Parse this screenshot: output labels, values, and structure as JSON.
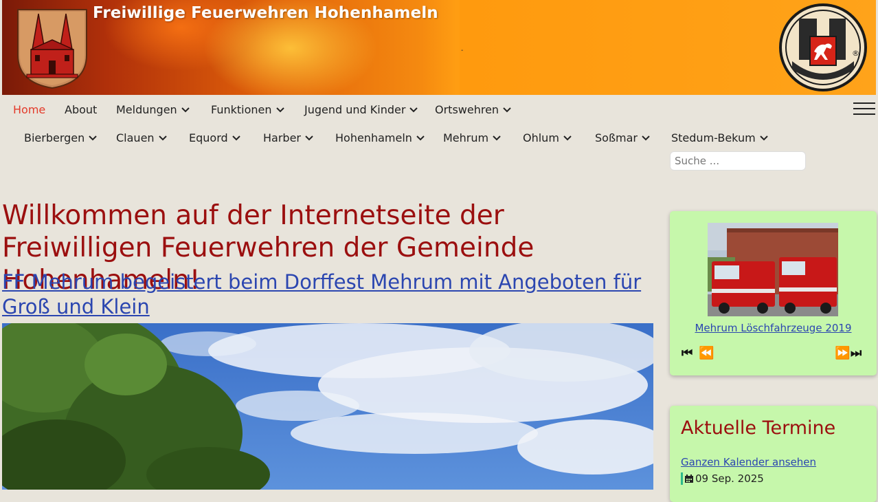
{
  "header": {
    "title": "Freiwillige Feuerwehren Hohenhameln",
    "separator": "-"
  },
  "nav": {
    "primary": [
      {
        "label": "Home",
        "active": true,
        "dropdown": false
      },
      {
        "label": "About",
        "dropdown": false
      },
      {
        "label": "Meldungen",
        "dropdown": true
      },
      {
        "label": "Funktionen",
        "dropdown": true
      },
      {
        "label": "Jugend und Kinder",
        "dropdown": true
      },
      {
        "label": "Ortswehren",
        "dropdown": true
      }
    ],
    "secondary": [
      {
        "label": "Bierbergen"
      },
      {
        "label": "Clauen"
      },
      {
        "label": "Equord"
      },
      {
        "label": "Harber"
      },
      {
        "label": "Hohenhameln"
      },
      {
        "label": "Mehrum"
      },
      {
        "label": "Ohlum"
      },
      {
        "label": "Soßmar"
      },
      {
        "label": "Stedum-Bekum"
      }
    ],
    "search_placeholder": "Suche ..."
  },
  "main": {
    "title": "Willkommen auf der Internetseite der Freiwilligen Feuerwehren der Gemeinde Hohenhameln!",
    "article_link": "FF Mehrum begeistert beim Dorffest Mehrum mit Angeboten für Groß und Klein"
  },
  "sidebar": {
    "gallery": {
      "caption": "Mehrum Löschfahrzeuge 2019",
      "controls": {
        "first": "⏮",
        "prev": "⏪",
        "next": "⏩",
        "last": "⏭"
      }
    },
    "events": {
      "title": "Aktuelle Termine",
      "calendar_link": "Ganzen Kalender ansehen",
      "first_date": "09 Sep. 2025"
    }
  },
  "colors": {
    "accent_red": "#9b0f0f",
    "link_blue": "#2b46b0",
    "nav_active": "#e33a2a",
    "widget_green": "#c6f7ab",
    "page_bg": "#e8e4db"
  }
}
